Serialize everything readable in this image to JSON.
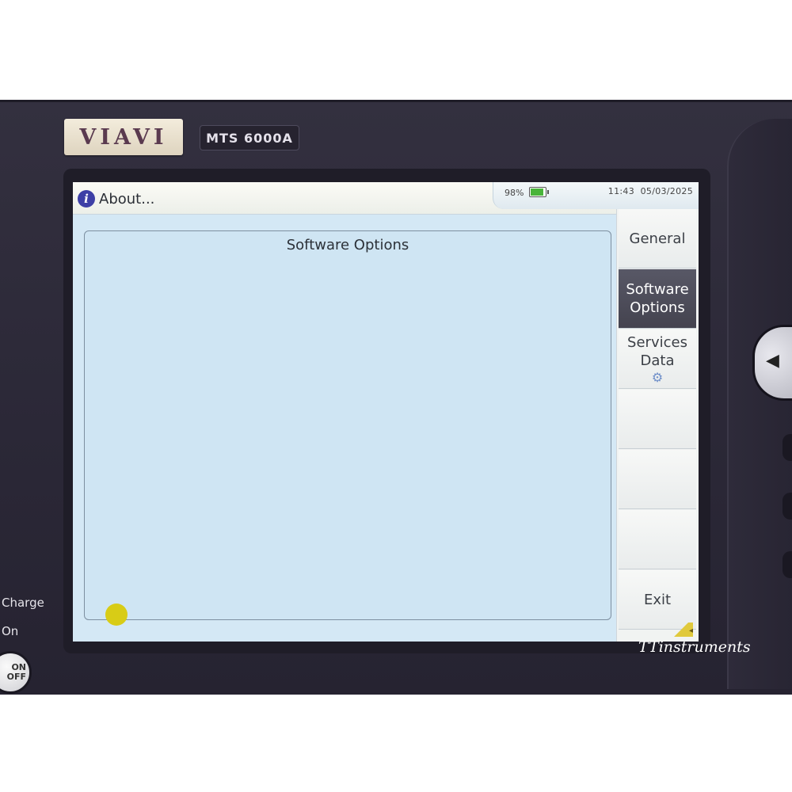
{
  "device": {
    "brand": "VIAVI",
    "model": "MTS 6000A"
  },
  "screen": {
    "window_title": "About...",
    "status": {
      "battery_percent": "98%",
      "battery_level": 0.98,
      "time": "11:43",
      "date": "05/03/2025"
    },
    "panel_title": "Software Options",
    "menu": [
      {
        "label_line1": "General",
        "label_line2": ""
      },
      {
        "label_line1": "Software",
        "label_line2": "Options"
      },
      {
        "label_line1": "Services",
        "label_line2": "Data"
      },
      {
        "label_line1": "",
        "label_line2": ""
      },
      {
        "label_line1": "",
        "label_line2": ""
      },
      {
        "label_line1": "",
        "label_line2": ""
      },
      {
        "label_line1": "Exit",
        "label_line2": ""
      }
    ],
    "active_menu": "Software Options"
  },
  "hardware": {
    "charge_label": "Charge",
    "on_label": "On",
    "power_button_line1": "ON",
    "power_button_line2": "OFF"
  },
  "watermark": "TTinstruments",
  "colors": {
    "screen_bg": "#d4e8f5",
    "active_menu_bg": "#4f4e5b",
    "bezel": "#2b2837",
    "info_icon": "#3d3fa6",
    "battery_green": "#49b43a",
    "indicator_dot": "#d8cc16"
  }
}
